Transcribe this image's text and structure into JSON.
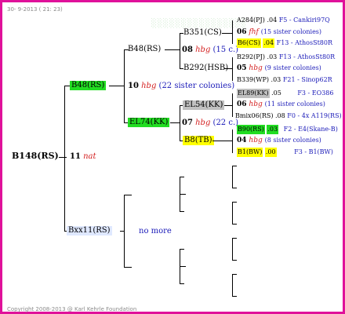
{
  "header": {
    "date": "30- 9-2013 ( 21: 23)"
  },
  "footer": {
    "copyright": "Copyright 2008-2013 @ Karl Kehrle Foundation"
  },
  "root": {
    "label": "B148(RS)",
    "num": "11",
    "tag": "nat"
  },
  "gen1": {
    "top": {
      "label": "B48(RS)",
      "num": "10",
      "tag": "hbg",
      "desc": "(22 sister colonies)"
    },
    "bottom": {
      "label": "Bxx11(RS)",
      "note": "no more"
    }
  },
  "gen2": {
    "a": {
      "label": "B48(RS)"
    },
    "b": {
      "label": "EL74(KK)",
      "num": "07",
      "tag": "hbg",
      "desc": "(22 c.)"
    }
  },
  "gen2inner": {
    "a": {
      "num": "08",
      "tag": "hbg",
      "desc": "(15 c.)"
    }
  },
  "gen3": {
    "a": {
      "label": "B351(CS)"
    },
    "b": {
      "label": "B292(HSB)"
    },
    "c": {
      "label": "EL54(KK)"
    },
    "d": {
      "label": "B8(TB)"
    }
  },
  "gen4": [
    {
      "line1_label": "A284(PJ)",
      "line1_num": ".04",
      "line1_info": "F5 - Cankiri97Q",
      "num": "06",
      "tag": "fhf",
      "desc": "(15 sister colonies)",
      "line3_label": "B6(CS)",
      "line3_num": ".04",
      "line3_info": "F13 - AthosSt80R"
    },
    {
      "line1_label": "B292(PJ)",
      "line1_num": ".03",
      "line1_info": "F13 - AthosSt80R",
      "num": "05",
      "tag": "hbg",
      "desc": "(9 sister colonies)",
      "line3_label": "B339(WP)",
      "line3_num": ".03",
      "line3_info": "F21 - Sinop62R"
    },
    {
      "line1_label": "EL89(KK)",
      "line1_num": ".05",
      "line1_info": "F3 - EO386",
      "num": "06",
      "tag": "hbg",
      "desc": "(11 sister colonies)",
      "line3_label": "Bmix06(RS)",
      "line3_num": ".08",
      "line3_info": "F0 - 4x A119(RS)"
    },
    {
      "line1_label": "B90(RS)",
      "line1_num": ".03",
      "line1_info": "F2 - E4(Skane-B)",
      "num": "04",
      "tag": "hbg",
      "desc": "(8 sister colonies)",
      "line3_label": "B1(BW)",
      "line3_num": ".00",
      "line3_info": "F3 - B1(BW)"
    }
  ]
}
